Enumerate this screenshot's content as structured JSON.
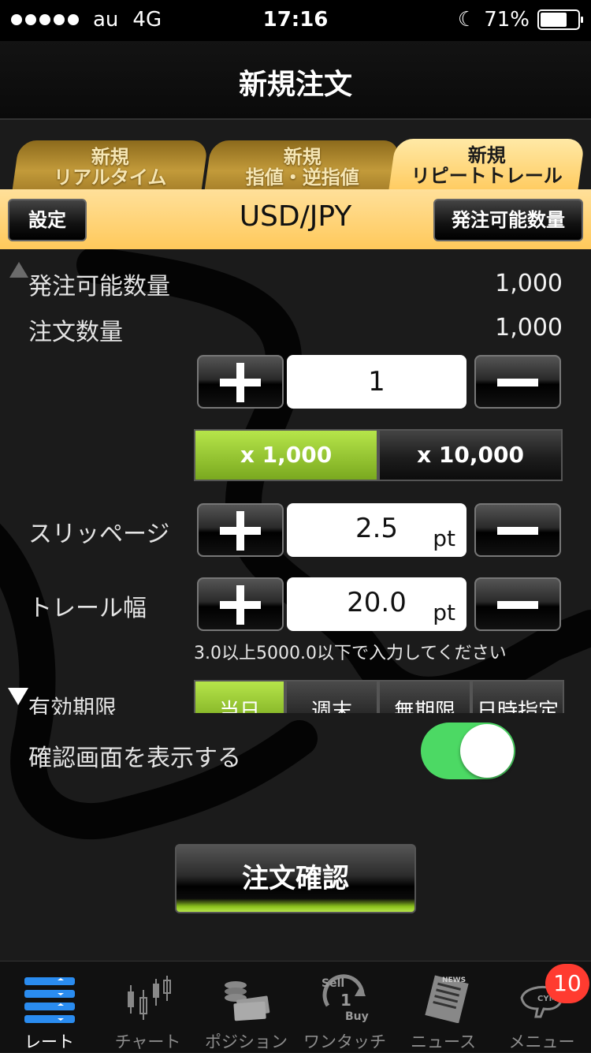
{
  "status_bar": {
    "carrier": "au",
    "network": "4G",
    "time": "17:16",
    "battery_percent": "71%",
    "battery_level": 0.71
  },
  "nav": {
    "title": "新規注文"
  },
  "tabs": [
    {
      "line1": "新規",
      "line2": "リアルタイム",
      "active": false
    },
    {
      "line1": "新規",
      "line2": "指値・逆指値",
      "active": false
    },
    {
      "line1": "新規",
      "line2": "リピートトレール",
      "active": true
    }
  ],
  "order_bar": {
    "settings_label": "設定",
    "pair": "USD/JPY",
    "available_qty_label": "発注可能数量"
  },
  "form": {
    "available_qty_label": "発注可能数量",
    "available_qty_value": "1,000",
    "order_qty_label": "注文数量",
    "order_qty_value": "1,000",
    "qty_input": "1",
    "multipliers": [
      {
        "label": "x 1,000",
        "selected": true
      },
      {
        "label": "x 10,000",
        "selected": false
      }
    ],
    "slippage_label": "スリッページ",
    "slippage_value": "2.5",
    "slippage_unit": "pt",
    "trail_label": "トレール幅",
    "trail_value": "20.0",
    "trail_unit": "pt",
    "trail_hint": "3.0以上5000.0以下で入力してください",
    "expiry_label": "有効期限",
    "expiry_options": [
      {
        "label": "当日",
        "selected": true
      },
      {
        "label": "週末",
        "selected": false
      },
      {
        "label": "無期限",
        "selected": false
      },
      {
        "label": "日時指定",
        "selected": false
      }
    ],
    "confirm_screen_label": "確認画面を表示する",
    "confirm_screen_on": true,
    "submit_label": "注文確認"
  },
  "tabbar": {
    "items": [
      {
        "label": "レート",
        "icon": "rate-icon",
        "active": true
      },
      {
        "label": "チャート",
        "icon": "chart-icon",
        "active": false
      },
      {
        "label": "ポジション",
        "icon": "position-icon",
        "active": false
      },
      {
        "label": "ワンタッチ",
        "icon": "one-touch-icon",
        "active": false,
        "icon_text_top": "Sell",
        "icon_text_mid": "1",
        "icon_text_bottom": "Buy"
      },
      {
        "label": "ニュース",
        "icon": "news-icon",
        "active": false,
        "icon_text": "NEWS"
      },
      {
        "label": "メニュー",
        "icon": "menu-icon",
        "active": false,
        "icon_text": "CYMO"
      }
    ],
    "menu_badge": "10"
  },
  "colors": {
    "accent_green": "#7aa91f",
    "tab_gold": "#c29a3a",
    "order_bar": "#ffd67a",
    "toggle_on": "#4cd964",
    "badge": "#ff3b30"
  }
}
